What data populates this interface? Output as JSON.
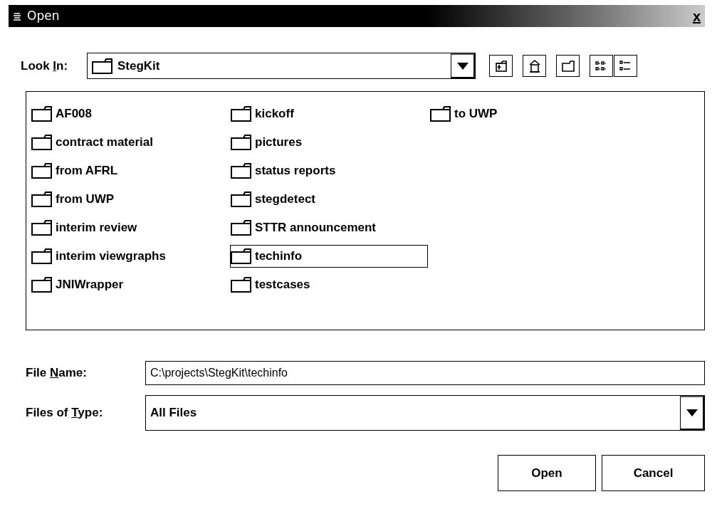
{
  "window": {
    "title": "Open",
    "close": "x"
  },
  "look_in": {
    "label": {
      "before": "Look ",
      "mnemonic": "I",
      "after": "n:"
    },
    "value": "StegKit"
  },
  "toolbar": [
    {
      "kind": "up"
    },
    {
      "kind": "home"
    },
    {
      "kind": "new-folder"
    },
    {
      "kind": "list",
      "selected": false
    },
    {
      "kind": "details",
      "selected": false
    }
  ],
  "files": [
    {
      "name": "AF008",
      "selected": false
    },
    {
      "name": "contract material",
      "selected": false
    },
    {
      "name": "from AFRL",
      "selected": false
    },
    {
      "name": "from UWP",
      "selected": false
    },
    {
      "name": "interim review",
      "selected": false
    },
    {
      "name": "interim viewgraphs",
      "selected": false
    },
    {
      "name": "JNIWrapper",
      "selected": false
    },
    {
      "name": "kickoff",
      "selected": false
    },
    {
      "name": "pictures",
      "selected": false
    },
    {
      "name": "status reports",
      "selected": false
    },
    {
      "name": "stegdetect",
      "selected": false
    },
    {
      "name": "STTR announcement",
      "selected": false
    },
    {
      "name": "techinfo",
      "selected": true
    },
    {
      "name": "testcases",
      "selected": false
    },
    {
      "name": "to UWP",
      "selected": false
    }
  ],
  "file_name": {
    "label": {
      "before": "File ",
      "mnemonic": "N",
      "after": "ame:"
    },
    "value": "C:\\projects\\StegKit\\techinfo"
  },
  "files_of_type": {
    "label": {
      "before": "Files of ",
      "mnemonic": "T",
      "after": "ype:"
    },
    "value": "All Files"
  },
  "buttons": [
    "Open",
    "Cancel"
  ]
}
